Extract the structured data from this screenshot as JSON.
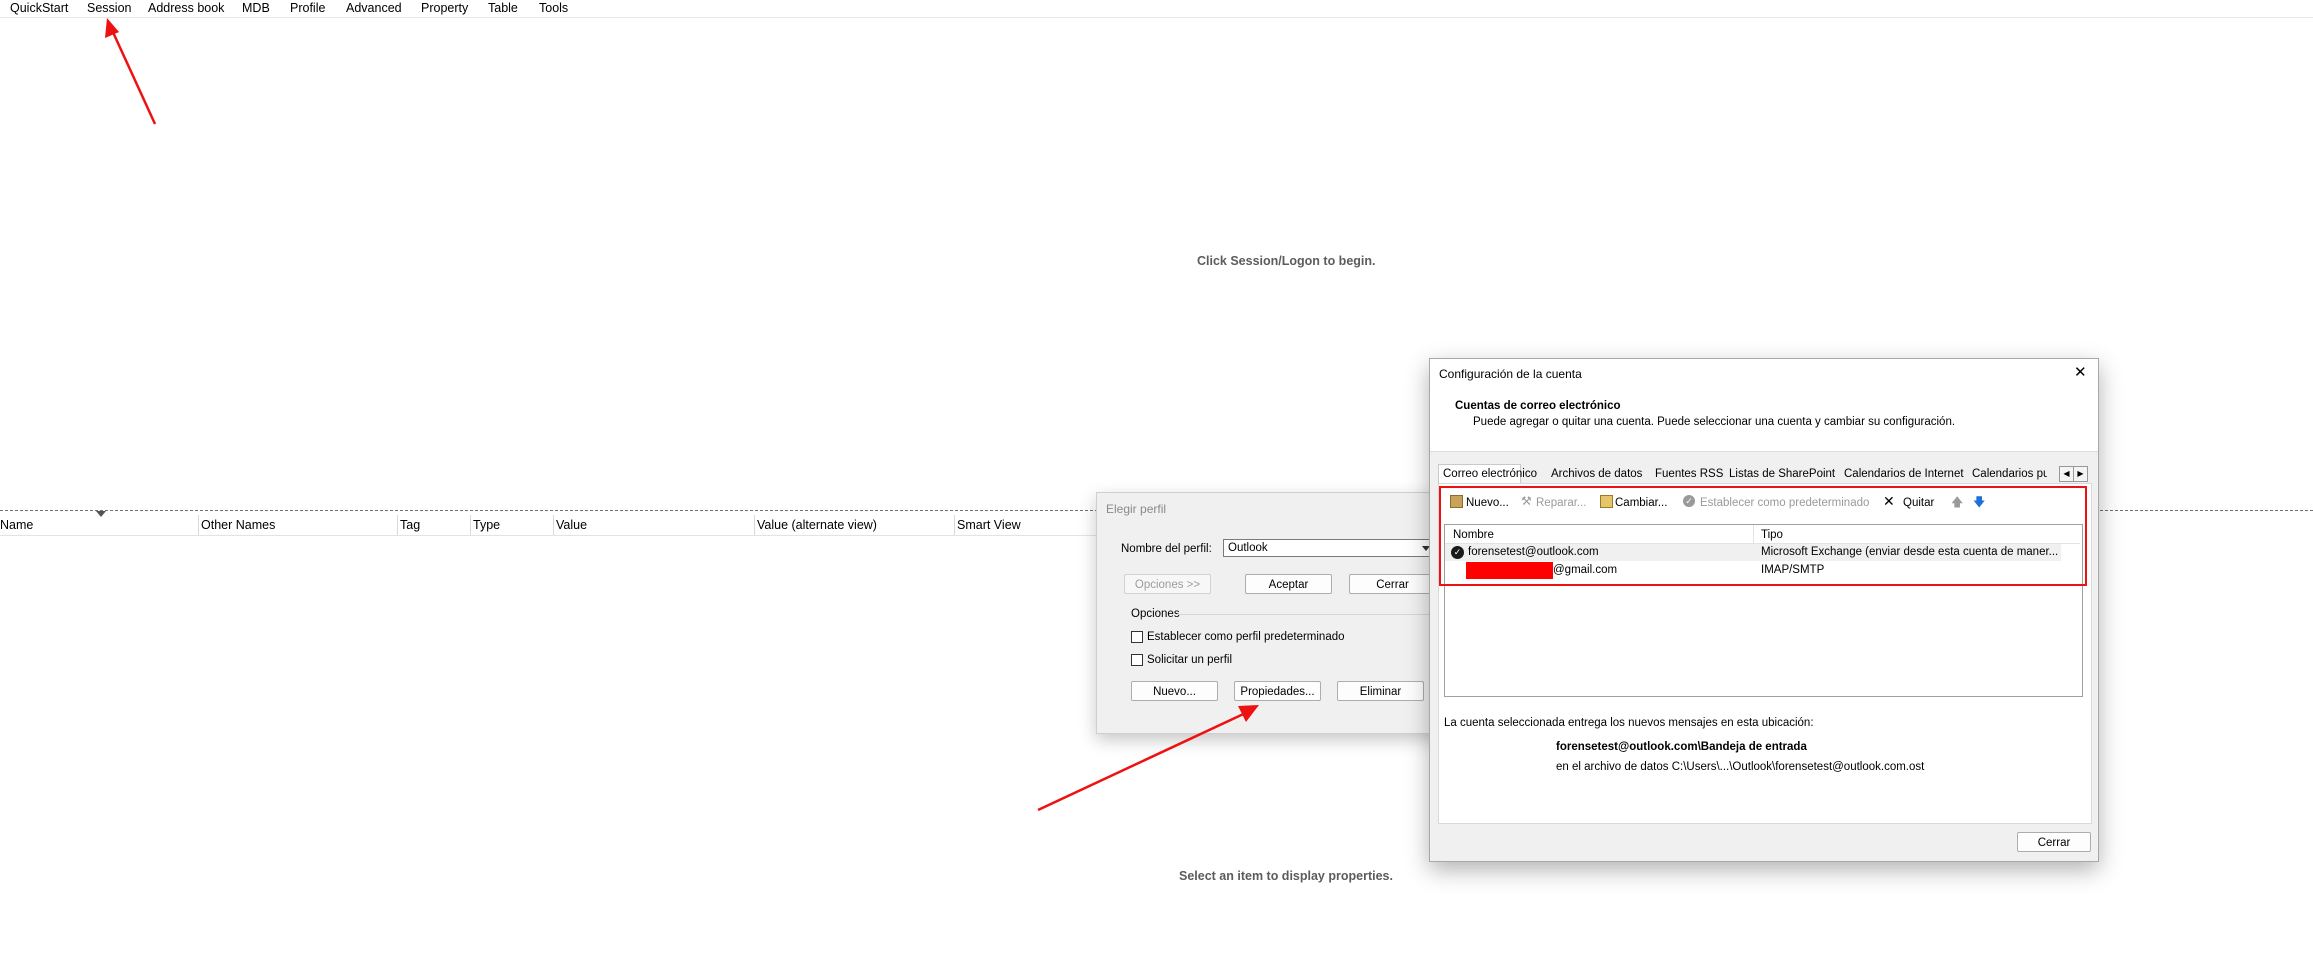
{
  "menu": [
    "QuickStart",
    "Session",
    "Address book",
    "MDB",
    "Profile",
    "Advanced",
    "Property",
    "Table",
    "Tools"
  ],
  "hints": {
    "top": "Click Session/Logon to begin.",
    "bottom": "Select an item to display properties."
  },
  "columns": [
    "Name",
    "Other Names",
    "Tag",
    "Type",
    "Value",
    "Value (alternate view)",
    "Smart View"
  ],
  "choose_profile": {
    "title": "Elegir perfil",
    "profile_label": "Nombre del perfil:",
    "profile_value": "Outlook",
    "options_btn": "Opciones >>",
    "accept_btn": "Aceptar",
    "close_btn": "Cerrar",
    "options_group": "Opciones",
    "set_default": "Establecer como perfil predeterminado",
    "ask_profile": "Solicitar un perfil",
    "new_btn": "Nuevo...",
    "properties_btn": "Propiedades...",
    "delete_btn": "Eliminar"
  },
  "account_settings": {
    "title": "Configuración de la cuenta",
    "heading": "Cuentas de correo electrónico",
    "description": "Puede agregar o quitar una cuenta. Puede seleccionar una cuenta y cambiar su configuración.",
    "tabs": [
      "Correo electrónico",
      "Archivos de datos",
      "Fuentes RSS",
      "Listas de SharePoint",
      "Calendarios de Internet",
      "Calendarios pul"
    ],
    "toolbar": {
      "new": "Nuevo...",
      "repair": "Reparar...",
      "change": "Cambiar...",
      "set_default": "Establecer como predeterminado",
      "remove": "Quitar"
    },
    "list_headers": {
      "name": "Nombre",
      "type": "Tipo"
    },
    "accounts": [
      {
        "name": "forensetest@outlook.com",
        "type": "Microsoft Exchange (enviar desde esta cuenta de maner..."
      },
      {
        "name": "@gmail.com",
        "type": "IMAP/SMTP"
      }
    ],
    "delivery_text": "La cuenta seleccionada entrega los nuevos mensajes en esta ubicación:",
    "delivery_folder": "forensetest@outlook.com\\Bandeja de entrada",
    "delivery_file": "en el archivo de datos C:\\Users\\...\\Outlook\\forensetest@outlook.com.ost",
    "close_btn": "Cerrar"
  },
  "colors": {
    "annotation_red": "#ee1111",
    "redaction_red": "#ff0000",
    "accent_blue": "#1e6fd6"
  }
}
